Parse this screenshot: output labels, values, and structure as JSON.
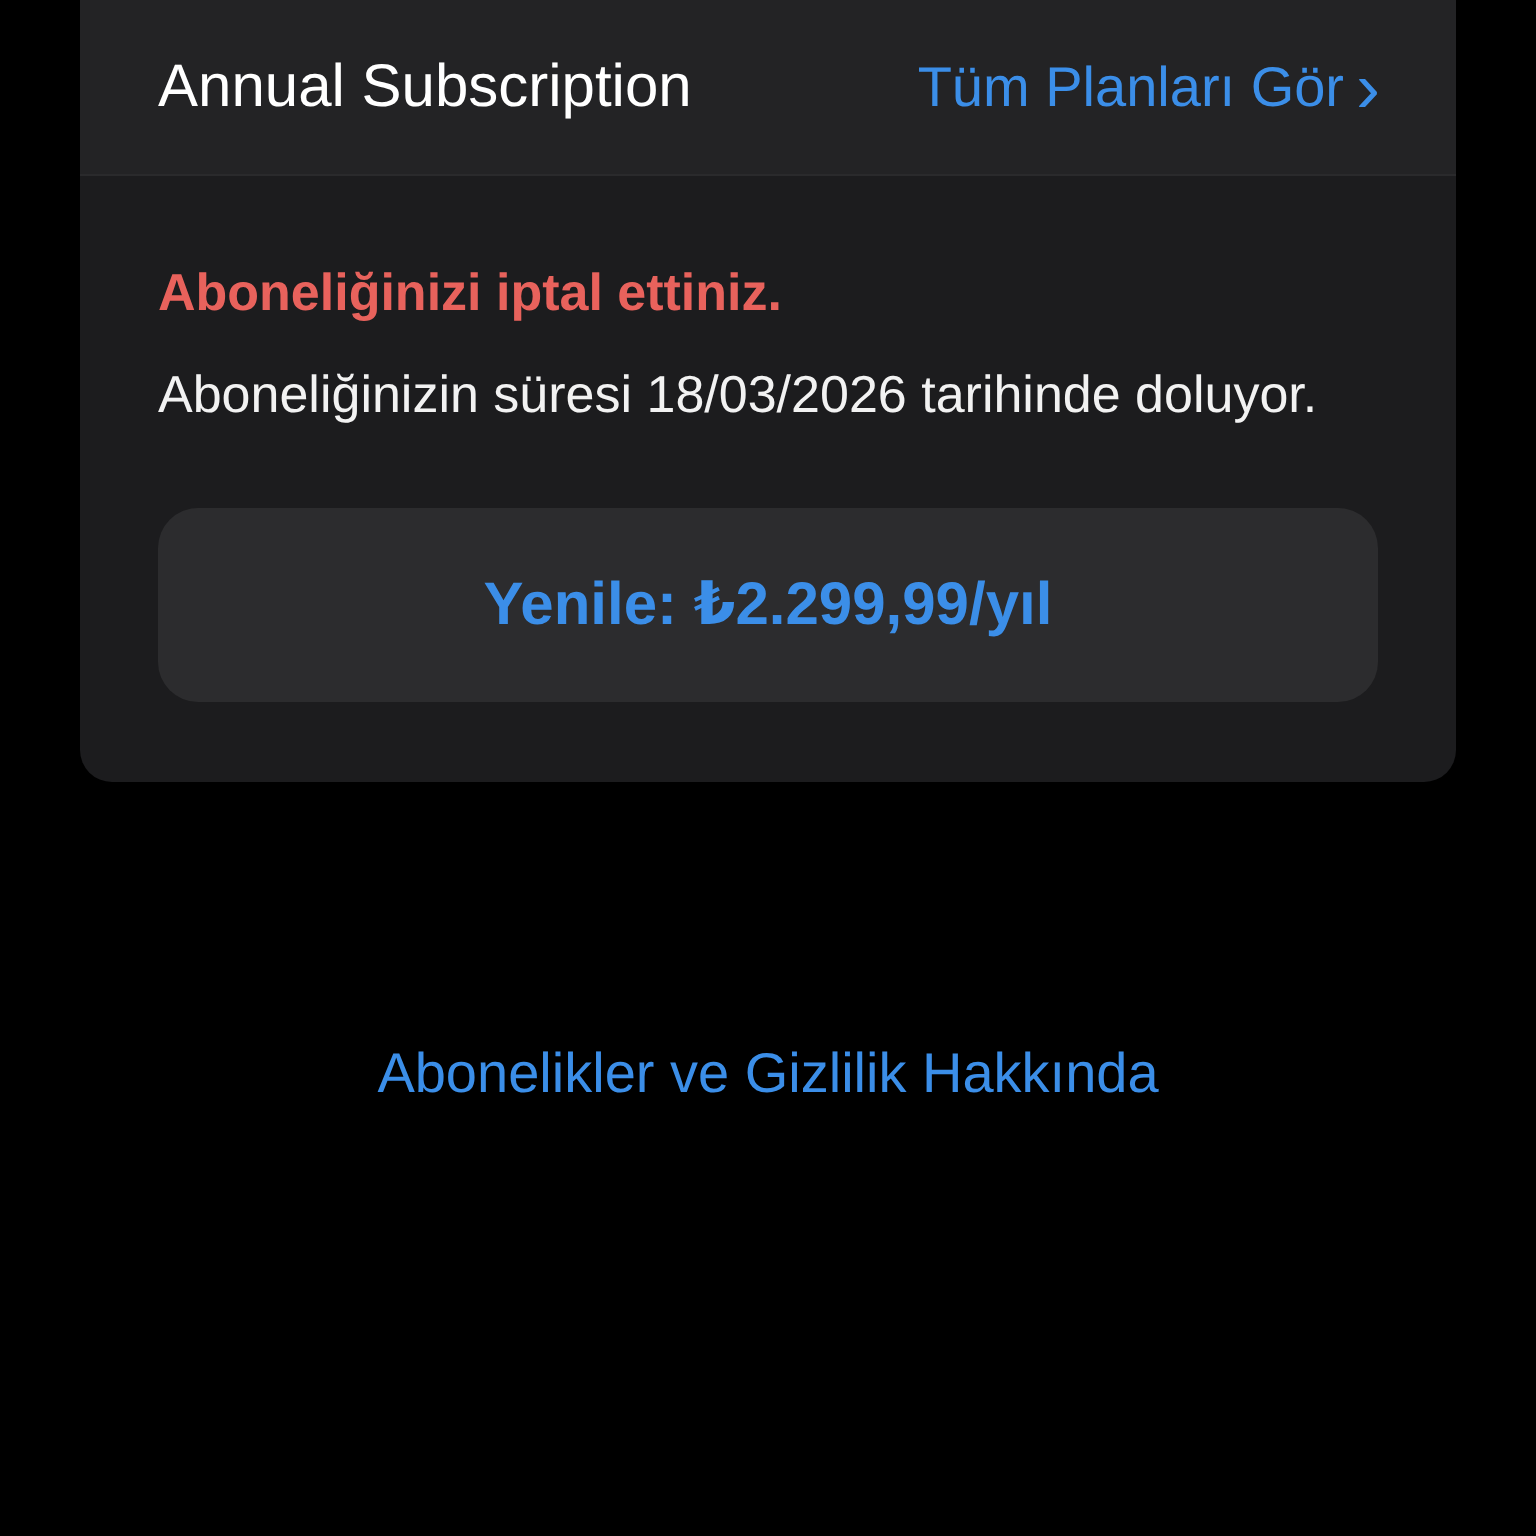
{
  "card": {
    "title": "Annual Subscription",
    "link": "Tüm Planları Gör",
    "link_chevron": "›",
    "status": "Aboneliğinizi iptal ettiniz.",
    "description": "Aboneliğinizin süresi 18/03/2026 tarihinde doluyor.",
    "button": "Yenile: ₺2.299,99/yıl"
  },
  "footer_link": "Abonelikler ve Gizlilik Hakkında"
}
